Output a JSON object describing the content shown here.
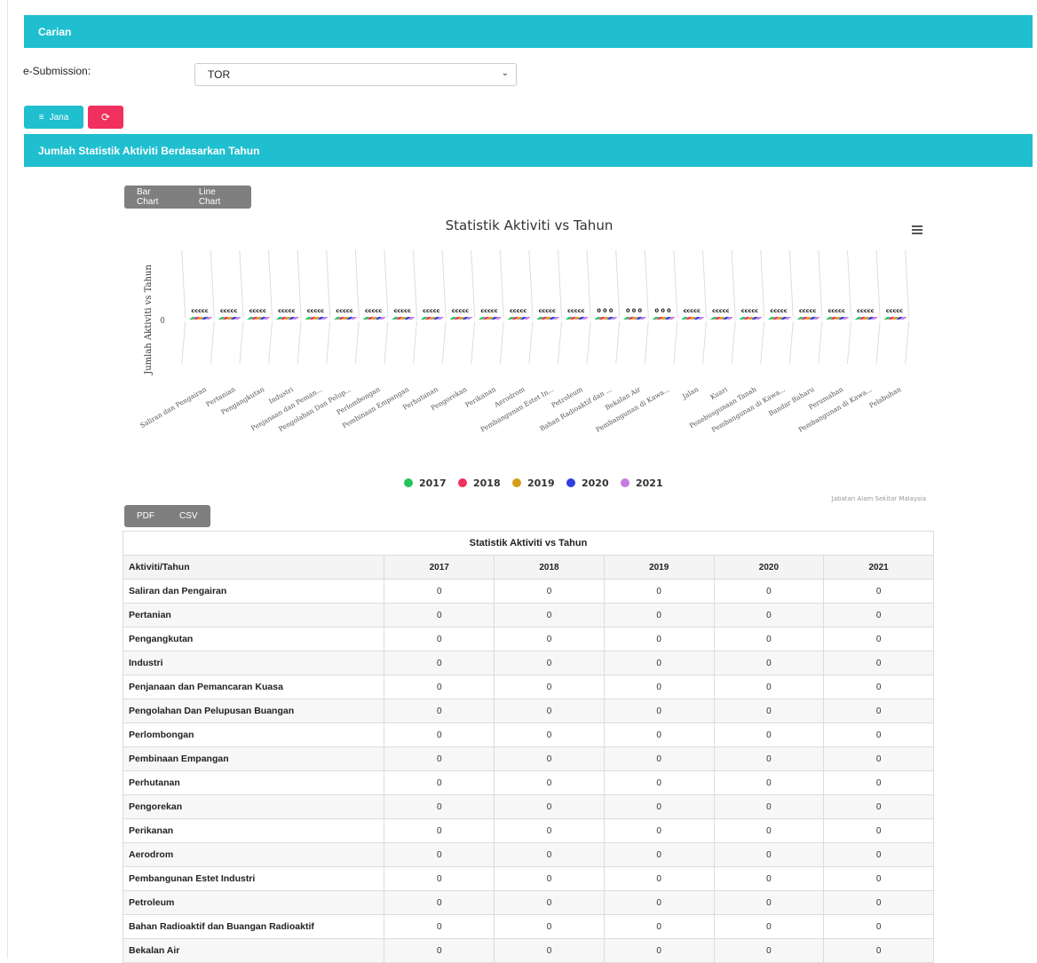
{
  "carian": {
    "title": "Carian"
  },
  "form": {
    "label": "e-Submission:",
    "selected": "TOR"
  },
  "buttons": {
    "jana": "Jana"
  },
  "section": {
    "title": "Jumlah Statistik Aktiviti Berdasarkan Tahun"
  },
  "chart_tabs": [
    "Bar Chart",
    "Line Chart"
  ],
  "export_tabs": [
    "PDF",
    "CSV"
  ],
  "chart_data": {
    "type": "bar",
    "title": "Statistik Aktiviti vs Tahun",
    "ylabel": "Jumlah Aktiviti vs Tahun",
    "credits": "Jabatan Alam Sekitar Malaysia",
    "y_tick": "0",
    "categories": [
      "Saliran dan Pengairan",
      "Pertanian",
      "Pengangkutan",
      "Industri",
      "Penjanaan dan Peman...",
      "Pengolahan Dan Pelup...",
      "Perlombongan",
      "Pembinaan Empangan",
      "Perhutanan",
      "Pengorekan",
      "Perikanan",
      "Aerodrom",
      "Pembangunan Estet In...",
      "Petroleum",
      "Bahan Radioaktif dan ...",
      "Bekalan Air",
      "Pembangunan di Kawa...",
      "Jalan",
      "Kuari",
      "Penebusgunaan Tanah",
      "Pembangunan di Kawa...",
      "Bandar Baharu",
      "Perumahan",
      "Pembangunan di Kawa...",
      "Pelabuhan"
    ],
    "series": [
      {
        "name": "2017",
        "color": "#22c55e",
        "values": [
          0,
          0,
          0,
          0,
          0,
          0,
          0,
          0,
          0,
          0,
          0,
          0,
          0,
          0,
          0,
          0,
          0,
          0,
          0,
          0,
          0,
          0,
          0,
          0,
          0
        ]
      },
      {
        "name": "2018",
        "color": "#f0305e",
        "values": [
          0,
          0,
          0,
          0,
          0,
          0,
          0,
          0,
          0,
          0,
          0,
          0,
          0,
          0,
          0,
          0,
          0,
          0,
          0,
          0,
          0,
          0,
          0,
          0,
          0
        ]
      },
      {
        "name": "2019",
        "color": "#d4a017",
        "values": [
          0,
          0,
          0,
          0,
          0,
          0,
          0,
          0,
          0,
          0,
          0,
          0,
          0,
          0,
          0,
          0,
          0,
          0,
          0,
          0,
          0,
          0,
          0,
          0,
          0
        ]
      },
      {
        "name": "2020",
        "color": "#2f3fe0",
        "values": [
          0,
          0,
          0,
          0,
          0,
          0,
          0,
          0,
          0,
          0,
          0,
          0,
          0,
          0,
          0,
          0,
          0,
          0,
          0,
          0,
          0,
          0,
          0,
          0,
          0
        ]
      },
      {
        "name": "2021",
        "color": "#c77ddf",
        "values": [
          0,
          0,
          0,
          0,
          0,
          0,
          0,
          0,
          0,
          0,
          0,
          0,
          0,
          0,
          0,
          0,
          0,
          0,
          0,
          0,
          0,
          0,
          0,
          0,
          0
        ]
      }
    ],
    "data_labels": [
      "ccccc",
      "ccccc",
      "ccccc",
      "ccccc",
      "ccccc",
      "ccccc",
      "ccccc",
      "ccccc",
      "ccccc",
      "ccccc",
      "ccccc",
      "ccccc",
      "ccccc",
      "ccccc",
      "0 0 0",
      "0 0 0",
      "0 0 0",
      "ccccc",
      "ccccc",
      "ccccc",
      "ccccc",
      "ccccc",
      "ccccc",
      "ccccc",
      "ccccc"
    ]
  },
  "table": {
    "caption": "Statistik Aktiviti vs Tahun",
    "headers": [
      "Aktiviti/Tahun",
      "2017",
      "2018",
      "2019",
      "2020",
      "2021"
    ],
    "rows": [
      {
        "name": "Saliran dan Pengairan",
        "values": [
          "0",
          "0",
          "0",
          "0",
          "0"
        ]
      },
      {
        "name": "Pertanian",
        "values": [
          "0",
          "0",
          "0",
          "0",
          "0"
        ]
      },
      {
        "name": "Pengangkutan",
        "values": [
          "0",
          "0",
          "0",
          "0",
          "0"
        ]
      },
      {
        "name": "Industri",
        "values": [
          "0",
          "0",
          "0",
          "0",
          "0"
        ]
      },
      {
        "name": "Penjanaan dan Pemancaran Kuasa",
        "values": [
          "0",
          "0",
          "0",
          "0",
          "0"
        ]
      },
      {
        "name": "Pengolahan Dan Pelupusan Buangan",
        "values": [
          "0",
          "0",
          "0",
          "0",
          "0"
        ]
      },
      {
        "name": "Perlombongan",
        "values": [
          "0",
          "0",
          "0",
          "0",
          "0"
        ]
      },
      {
        "name": "Pembinaan Empangan",
        "values": [
          "0",
          "0",
          "0",
          "0",
          "0"
        ]
      },
      {
        "name": "Perhutanan",
        "values": [
          "0",
          "0",
          "0",
          "0",
          "0"
        ]
      },
      {
        "name": "Pengorekan",
        "values": [
          "0",
          "0",
          "0",
          "0",
          "0"
        ]
      },
      {
        "name": "Perikanan",
        "values": [
          "0",
          "0",
          "0",
          "0",
          "0"
        ]
      },
      {
        "name": "Aerodrom",
        "values": [
          "0",
          "0",
          "0",
          "0",
          "0"
        ]
      },
      {
        "name": "Pembangunan Estet Industri",
        "values": [
          "0",
          "0",
          "0",
          "0",
          "0"
        ]
      },
      {
        "name": "Petroleum",
        "values": [
          "0",
          "0",
          "0",
          "0",
          "0"
        ]
      },
      {
        "name": "Bahan Radioaktif dan Buangan Radioaktif",
        "values": [
          "0",
          "0",
          "0",
          "0",
          "0"
        ]
      },
      {
        "name": "Bekalan Air",
        "values": [
          "0",
          "0",
          "0",
          "0",
          "0"
        ]
      }
    ]
  }
}
